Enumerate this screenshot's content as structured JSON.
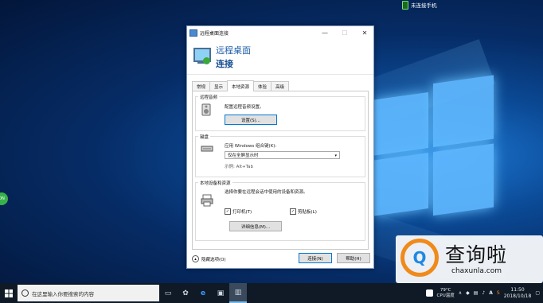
{
  "notification": {
    "text": "未连接手机"
  },
  "dialog": {
    "title": "远程桌面连接",
    "header_line1": "远程桌面",
    "header_line2": "连接",
    "tabs": [
      "常规",
      "显示",
      "本地资源",
      "体验",
      "高级"
    ],
    "active_tab": "本地资源",
    "remote_audio": {
      "label": "远程音频",
      "desc": "配置远程音频设置。",
      "button": "设置(S)..."
    },
    "keyboard": {
      "label": "键盘",
      "desc": "应用 Windows 组合键(K):",
      "selected": "仅在全屏显示时",
      "example": "示例: Alt+Tab"
    },
    "local_devices": {
      "label": "本地设备和资源",
      "desc": "选择你要在远程会话中使用的设备和资源。",
      "printer": "打印机(T)",
      "clipboard": "剪贴板(L)",
      "more_button": "详细信息(M)..."
    },
    "hide_options": "隐藏选项(O)",
    "connect_button": "连接(N)",
    "help_button": "帮助(H)"
  },
  "taskbar": {
    "search_placeholder": "在这里输入你要搜索的内容",
    "weather_temp": "79°C",
    "weather_label": "CPU温度",
    "time": "11:50",
    "date": "2018/10/18"
  },
  "watermark": {
    "brand_cn": "查询啦",
    "url": "chaxunla.com"
  },
  "colors": {
    "desktop_blue": "#0b4a96",
    "accent": "#0078d7",
    "taskbar": "#0f1a26",
    "watermark_orange": "#f08a1a"
  }
}
